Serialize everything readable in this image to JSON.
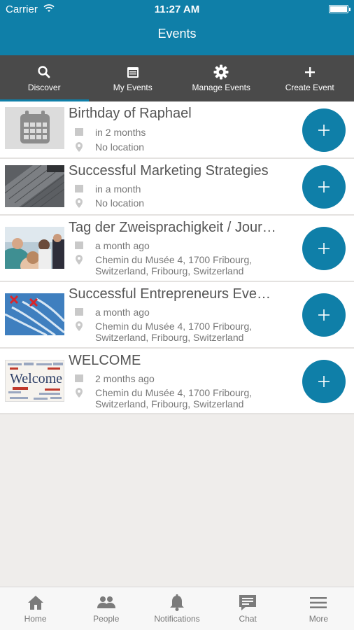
{
  "status_bar": {
    "carrier": "Carrier",
    "time": "11:27 AM"
  },
  "header": {
    "title": "Events"
  },
  "tabs": [
    {
      "label": "Discover",
      "icon": "search-icon",
      "active": true
    },
    {
      "label": "My Events",
      "icon": "calendar-icon"
    },
    {
      "label": "Manage Events",
      "icon": "gear-icon"
    },
    {
      "label": "Create Event",
      "icon": "plus-icon"
    }
  ],
  "events": [
    {
      "title": "Birthday of Raphael",
      "when": "in 2 months",
      "where": "No location"
    },
    {
      "title": "Successful Marketing Strategies",
      "when": "in a month",
      "where": "No location"
    },
    {
      "title": "Tag der Zweisprachigkeit / Jour…",
      "when": "a month ago",
      "where": "Chemin du Musée 4, 1700 Fribourg, Switzerland, Fribourg, Switzerland"
    },
    {
      "title": "Successful Entrepreneurs Eve…",
      "when": "a month ago",
      "where": "Chemin du Musée 4, 1700 Fribourg, Switzerland, Fribourg, Switzerland"
    },
    {
      "title": "WELCOME",
      "when": "2 months ago",
      "where": "Chemin du Musée 4, 1700 Fribourg, Switzerland, Fribourg, Switzerland"
    }
  ],
  "bottom_nav": [
    {
      "label": "Home",
      "icon": "home-icon"
    },
    {
      "label": "People",
      "icon": "people-icon"
    },
    {
      "label": "Notifications",
      "icon": "bell-icon"
    },
    {
      "label": "Chat",
      "icon": "chat-icon"
    },
    {
      "label": "More",
      "icon": "menu-icon"
    }
  ],
  "colors": {
    "accent": "#0f7fa8",
    "tab_bar": "#4a4a4a",
    "background": "#efedeb"
  },
  "thumbnail_text": {
    "welcome": "Welcome"
  }
}
